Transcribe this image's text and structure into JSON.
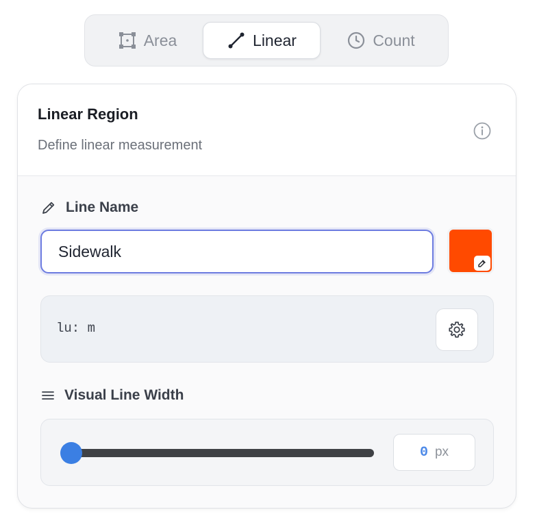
{
  "tabs": [
    {
      "label": "Area",
      "icon": "area-select-icon"
    },
    {
      "label": "Linear",
      "icon": "line-icon",
      "active": true
    },
    {
      "label": "Count",
      "icon": "clock-icon"
    }
  ],
  "panel": {
    "title": "Linear Region",
    "subtitle": "Define linear measurement"
  },
  "line_name": {
    "label": "Line Name",
    "value": "Sidewalk",
    "color": "#ff4a00"
  },
  "units": {
    "text": "lu: m"
  },
  "line_width": {
    "label": "Visual Line Width",
    "value": "0",
    "unit": "px",
    "slider_fraction": 0
  },
  "colors": {
    "accent": "#3b7fe3",
    "input_focus": "#6c7be0"
  }
}
